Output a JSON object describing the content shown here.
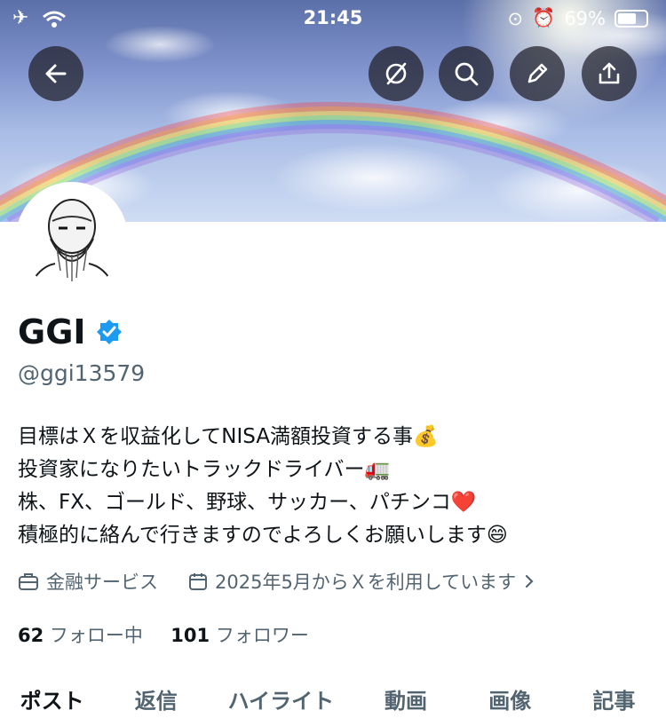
{
  "status_bar": {
    "time": "21:45",
    "battery": "69%"
  },
  "profile": {
    "name": "GGI",
    "handle": "@ggi13579",
    "bio": [
      "目標はＸを収益化してNISA満額投資する事💰",
      "投資家になりたいトラックドライバー🚛",
      "株、FX、ゴールド、野球、サッカー、パチンコ❤️",
      "積極的に絡んで行きますのでよろしくお願いします😄"
    ],
    "category": "金融サービス",
    "joined": "2025年5月からＸを利用しています",
    "following_count": "62",
    "following_label": "フォロー中",
    "followers_count": "101",
    "followers_label": "フォロワー"
  },
  "tabs": [
    "ポスト",
    "返信",
    "ハイライト",
    "動画",
    "画像",
    "記事"
  ],
  "icons": {
    "back": "back-arrow-icon",
    "grok": "grok-icon",
    "search": "search-icon",
    "edit": "pencil-icon",
    "share": "share-icon",
    "verified": "verified-badge-icon",
    "category": "briefcase-icon",
    "calendar": "calendar-icon"
  },
  "colors": {
    "verified": "#1d9bf0",
    "text": "#0f1419",
    "secondary": "#536471"
  }
}
